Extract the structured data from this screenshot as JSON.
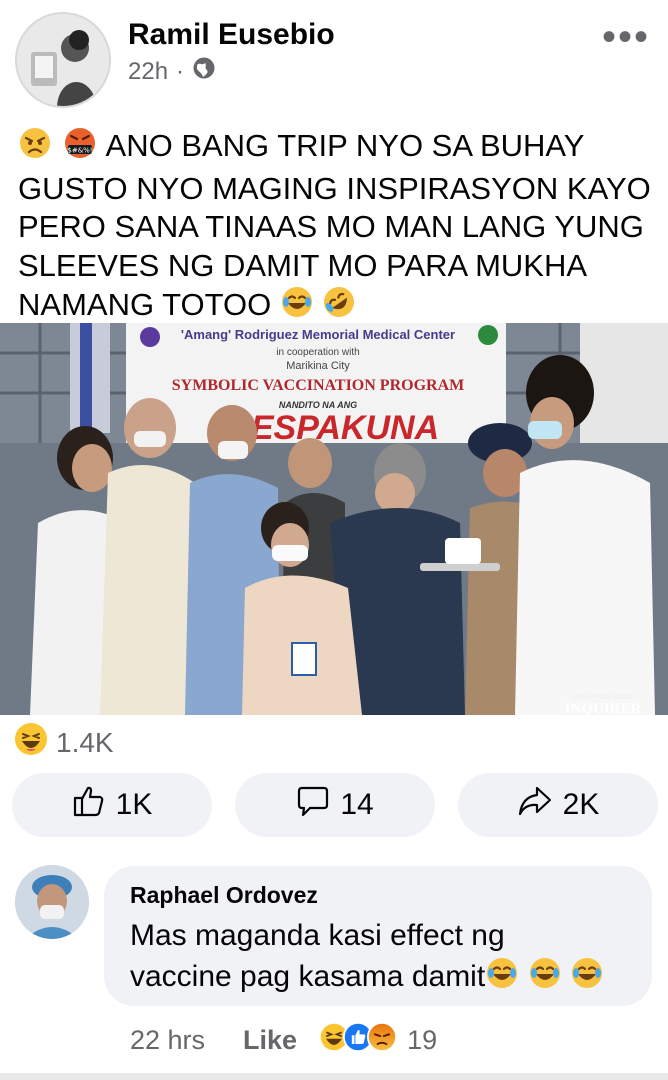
{
  "post": {
    "author": "Ramil Eusebio",
    "time": "22h",
    "separator": "·",
    "audience_icon": "globe-icon",
    "more_label": "•••",
    "text_lines": [
      "ANO BANG TRIP NYO SA BUHAY",
      "GUSTO NYO MAGING INSPIRASYON KAYO",
      "PERO SANA TINAAS MO MAN LANG YUNG",
      "SLEEVES NG DAMIT MO PARA MUKHA",
      "NAMANG TOTOO"
    ],
    "leading_emojis": [
      "weary-face-emoji",
      "cursing-face-emoji"
    ],
    "trailing_emojis": [
      "laughing-tears-emoji",
      "rolling-laughing-emoji"
    ]
  },
  "photo": {
    "banner_line1": "'Amang' Rodriguez Memorial Medical Center",
    "banner_line2": "in cooperation with",
    "banner_line3": "Marikina City",
    "banner_title": "SYMBOLIC VACCINATION PROGRAM",
    "banner_sub": "NANDITO NA ANG",
    "banner_big": "ESPAKUNA",
    "watermark_top": "PHILIPPINE DAILY",
    "watermark": "INQUIRER"
  },
  "reactions": {
    "count": "1.4K",
    "icon": "haha-reaction-icon"
  },
  "actions": {
    "like": {
      "label": "1K",
      "icon": "thumbs-up-icon"
    },
    "comment": {
      "label": "14",
      "icon": "comment-bubble-icon"
    },
    "share": {
      "label": "2K",
      "icon": "share-arrow-icon"
    }
  },
  "comment": {
    "author": "Raphael Ordovez",
    "text_lines": [
      "Mas maganda kasi effect ng",
      "vaccine pag kasama damit"
    ],
    "time": "22 hrs",
    "like_label": "Like",
    "reaction_count": "19",
    "reaction_icons": [
      "haha-reaction-icon",
      "like-reaction-icon",
      "angry-reaction-icon"
    ]
  },
  "colors": {
    "text": "#050505",
    "secondary": "#65676b",
    "button_bg": "#f0f2f5",
    "like_blue": "#1877f2",
    "emoji_yellow": "#fbc531"
  }
}
